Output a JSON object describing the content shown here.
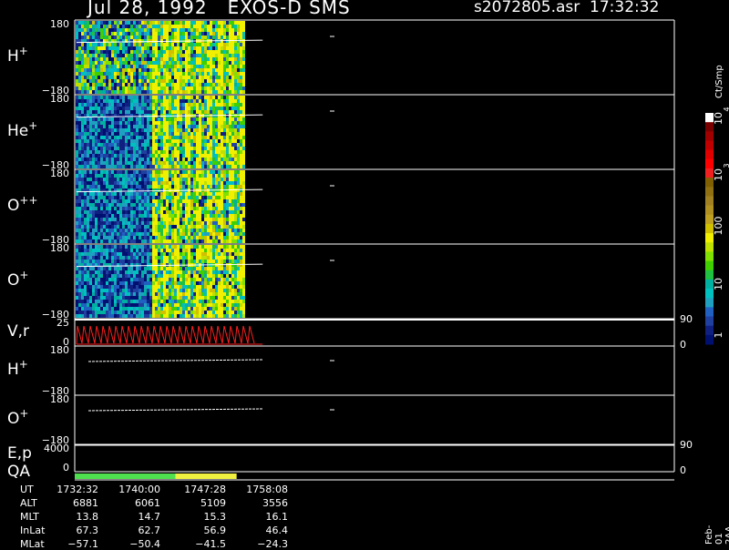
{
  "header": {
    "left": "Jul 28, 1992   EXOS-D SMS",
    "right": "s2072805.asr  17:32:32"
  },
  "panels": [
    {
      "id": "h-plus",
      "label": "H",
      "sup": "+",
      "type": "spectrogram",
      "ymax": "180",
      "ymin": "−180"
    },
    {
      "id": "he-plus",
      "label": "He",
      "sup": "+",
      "type": "spectrogram",
      "ymax": "180",
      "ymin": "−180"
    },
    {
      "id": "o-plusplus",
      "label": "O",
      "sup": "++",
      "type": "spectrogram",
      "ymax": "180",
      "ymin": "−180"
    },
    {
      "id": "o-plus",
      "label": "O",
      "sup": "+",
      "type": "spectrogram",
      "ymax": "180",
      "ymin": "−180"
    },
    {
      "id": "vr",
      "label": "V,r",
      "sup": "",
      "type": "line",
      "ymax": "25",
      "ymin": "0",
      "rmax": "90",
      "rmin": "0"
    },
    {
      "id": "h-plus-2",
      "label": "H",
      "sup": "+",
      "type": "trace",
      "ymax": "180",
      "ymin": "−180"
    },
    {
      "id": "o-plus-2",
      "label": "O",
      "sup": "+",
      "type": "trace",
      "ymax": "180",
      "ymin": "−180"
    },
    {
      "id": "ep",
      "label": "E,p",
      "sup": "",
      "type": "flat",
      "ymax": "4000",
      "ymin": "0",
      "rmax": "90",
      "rmin": "0"
    }
  ],
  "qa": {
    "label": "QA",
    "segments": [
      {
        "color": "#4fe04f",
        "from": 0.0,
        "to": 0.62
      },
      {
        "color": "#f0f040",
        "from": 0.62,
        "to": 1.0
      }
    ],
    "end_fraction": 0.27
  },
  "colorbar": {
    "unit": "Ct/Smp",
    "ticks": [
      "10",
      "4",
      "10",
      "3",
      "100",
      "10",
      "1"
    ],
    "colors": [
      "#ffffff",
      "#7a0000",
      "#a00000",
      "#c00000",
      "#e00000",
      "#ff0000",
      "#f02020",
      "#806000",
      "#907010",
      "#a08020",
      "#b09020",
      "#c0a020",
      "#d0c000",
      "#f0f000",
      "#c0e000",
      "#80e000",
      "#40d000",
      "#20c040",
      "#00b0a0",
      "#00c0c0",
      "#20a0c0",
      "#2060c0",
      "#2040a0",
      "#102080",
      "#001070"
    ]
  },
  "chart_data": {
    "type": "heatmap",
    "title": "Jul 28, 1992   EXOS-D SMS",
    "x_axis": {
      "label": "UT",
      "ticks": [
        "1732:32",
        "1740:00",
        "1747:28",
        "1758:08"
      ]
    },
    "data_coverage": {
      "start": "1732:32",
      "end_fraction_of_axis": 0.28
    },
    "series": [
      {
        "name": "H+",
        "yrange": [
          -180,
          180
        ]
      },
      {
        "name": "He+",
        "yrange": [
          -180,
          180
        ]
      },
      {
        "name": "O++",
        "yrange": [
          -180,
          180
        ]
      },
      {
        "name": "O+",
        "yrange": [
          -180,
          180
        ]
      },
      {
        "name": "V,r",
        "yrange": [
          0,
          25
        ],
        "right_range": [
          0,
          90
        ]
      },
      {
        "name": "E,p",
        "yrange": [
          0,
          4000
        ],
        "right_range": [
          0,
          90
        ]
      }
    ],
    "colorbar_label": "Ct/Smp",
    "colorbar_range": [
      1,
      10000
    ]
  },
  "footer": {
    "rows": [
      {
        "label": "UT",
        "values": [
          "1732:32",
          "1740:00",
          "1747:28",
          "1758:08"
        ]
      },
      {
        "label": "ALT",
        "values": [
          "6881",
          "6061",
          "5109",
          "3556"
        ]
      },
      {
        "label": "MLT",
        "values": [
          "13.8",
          "14.7",
          "15.3",
          "16.1"
        ]
      },
      {
        "label": "InLat",
        "values": [
          "67.3",
          "62.7",
          "56.9",
          "46.4"
        ]
      },
      {
        "label": "MLat",
        "values": [
          "−57.1",
          "−50.4",
          "−41.5",
          "−24.3"
        ]
      }
    ]
  },
  "stamp": "Feb-01 2AA"
}
